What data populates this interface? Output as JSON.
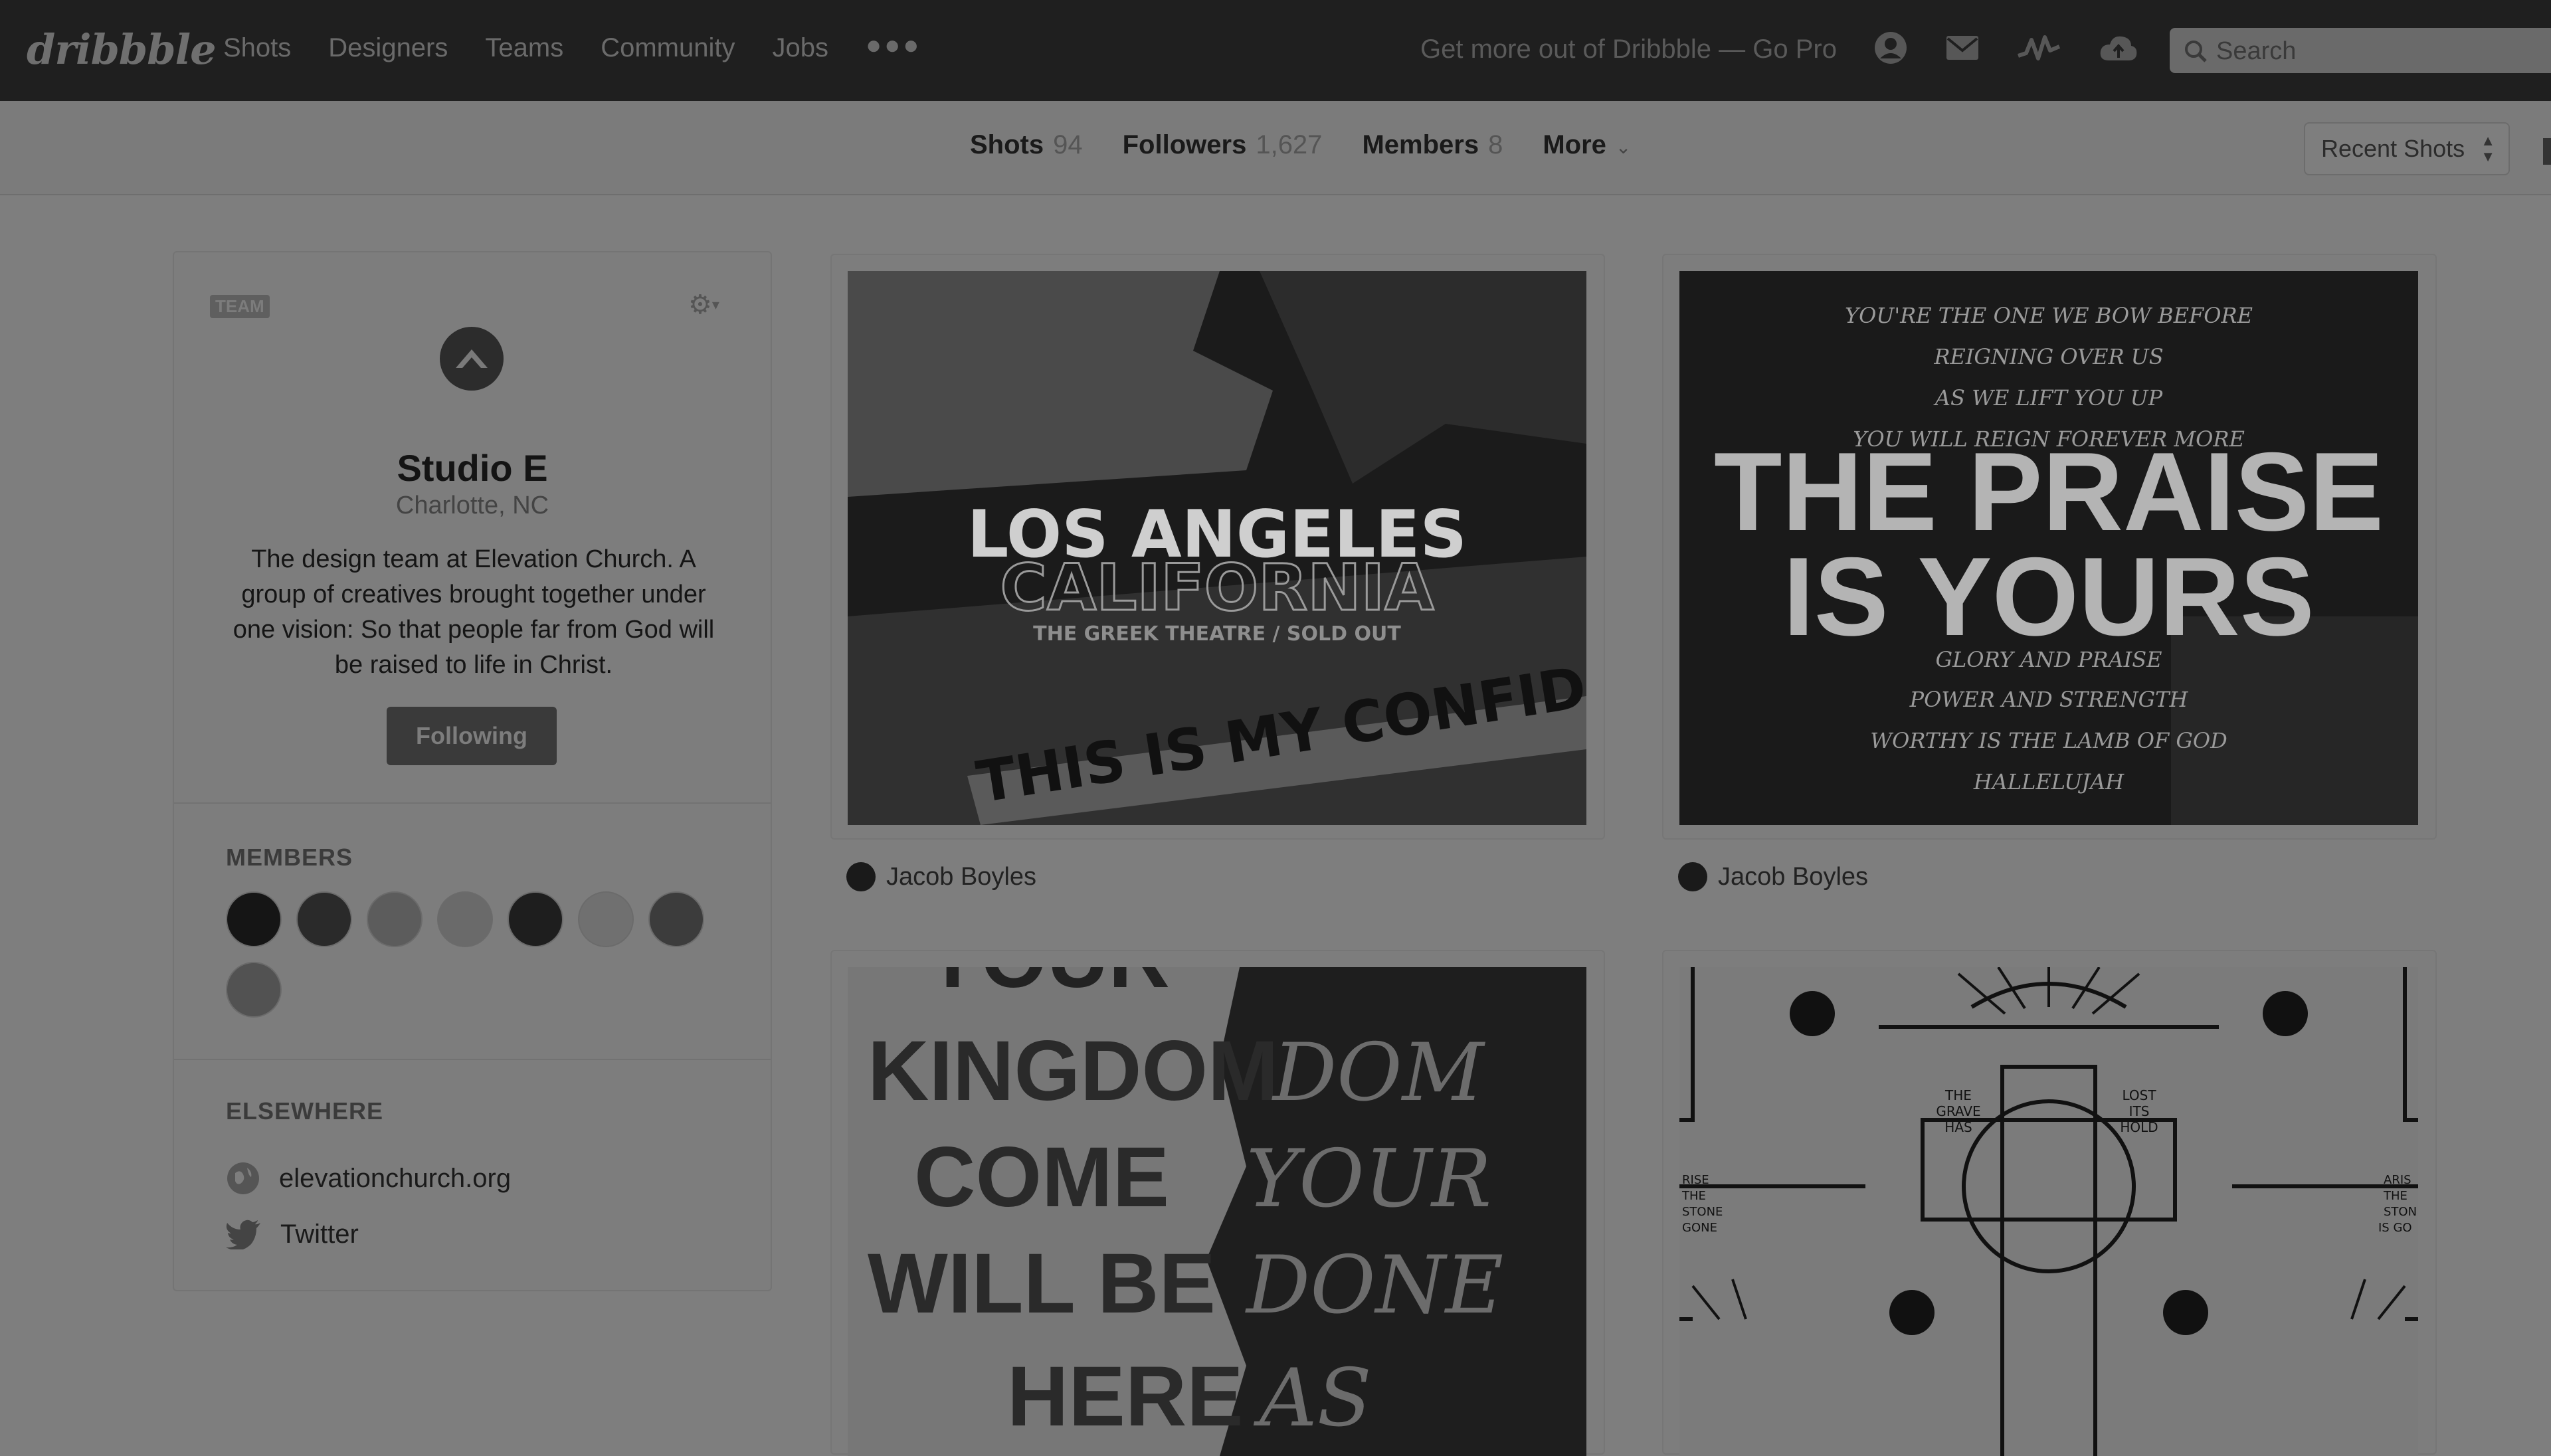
{
  "app": {
    "logo_text": "dribbble"
  },
  "nav": {
    "items": [
      "Shots",
      "Designers",
      "Teams",
      "Community",
      "Jobs"
    ],
    "more_icon": "more-dots-icon",
    "promo": "Get more out of Dribbble — Go Pro",
    "icons": [
      "user-icon",
      "mail-icon",
      "activity-icon",
      "upload-cloud-icon"
    ],
    "search_placeholder": "Search"
  },
  "subnav": {
    "tabs": [
      {
        "label": "Shots",
        "count": "94"
      },
      {
        "label": "Followers",
        "count": "1,627"
      },
      {
        "label": "Members",
        "count": "8"
      },
      {
        "label": "More",
        "count": ""
      }
    ],
    "sort_value": "Recent Shots"
  },
  "profile": {
    "badge": "TEAM",
    "name": "Studio E",
    "location": "Charlotte, NC",
    "bio": "The design team at Elevation Church. A group of creatives brought together under one vision: So that people far from God will be raised to life in Christ.",
    "follow_label": "Following",
    "members_title": "MEMBERS",
    "member_count_shown": 8,
    "elsewhere_title": "ELSEWHERE",
    "links": [
      {
        "icon": "globe-icon",
        "label": "elevationchurch.org"
      },
      {
        "icon": "twitter-icon",
        "label": "Twitter"
      }
    ]
  },
  "shots": [
    {
      "author": "Jacob Boyles",
      "art": {
        "line1": "LOS ANGELES",
        "line2": "CALIFORNIA",
        "line3": "THE GREEK THEATRE / SOLD OUT",
        "line4": "THIS IS MY CONFIDENCE"
      }
    },
    {
      "author": "Jacob Boyles",
      "art": {
        "script_lines": [
          "YOU'RE THE ONE WE BOW BEFORE",
          "REIGNING OVER US",
          "AS WE LIFT YOU UP",
          "YOU WILL REIGN FOREVER MORE"
        ],
        "headline": [
          "THE PRAISE",
          "IS YOURS"
        ],
        "script_lines2": [
          "GLORY AND PRAISE",
          "POWER AND STRENGTH",
          "WORTHY IS THE LAMB OF GOD",
          "HALLELUJAH"
        ]
      }
    },
    {
      "author": "",
      "art": {
        "lines_left": [
          "YOUR",
          "KINGDOM",
          "COME",
          "WILL BE",
          "HERE"
        ],
        "lines_right": [
          "DOM",
          "YOUR",
          "DONE",
          "AS"
        ]
      }
    },
    {
      "author": "",
      "art": {
        "corner_text_a": [
          "THE",
          "GRAVE",
          "HAS"
        ],
        "corner_text_b": [
          "LOST",
          "ITS",
          "HOLD"
        ],
        "side_left": [
          "RISE",
          "THE",
          "STONE",
          "GONE"
        ],
        "side_right": [
          "ARIS",
          "THE",
          "STON",
          "IS GO"
        ]
      }
    }
  ]
}
